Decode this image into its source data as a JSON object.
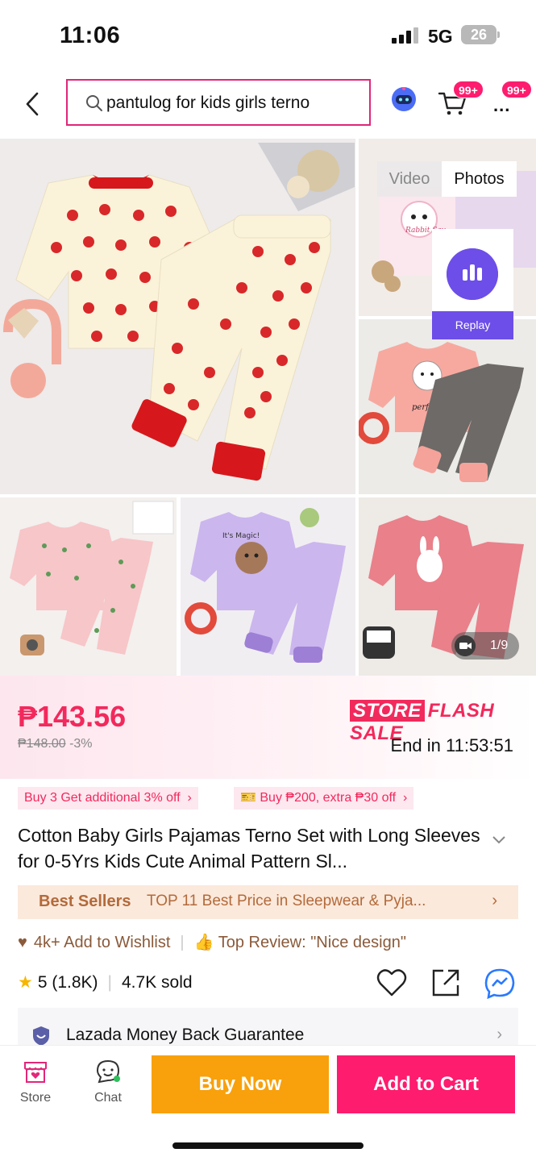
{
  "status_bar": {
    "time": "11:06",
    "network": "5G",
    "battery": "26"
  },
  "header": {
    "search_query": "pantulog for kids girls terno",
    "cart_badge": "99+",
    "more_badge": "99+",
    "more_label": "..."
  },
  "gallery": {
    "video_tab": "Video",
    "photos_tab": "Photos",
    "replay_label": "Replay",
    "image_counter": "1/9",
    "image_texts": {
      "rabbit": "Rabbit Sav",
      "kitty": "perfect day!",
      "magic": "It's Magic!"
    }
  },
  "pricing": {
    "price": "₱143.56",
    "original_price": "₱148.00",
    "discount": "-3%",
    "flash_store": "STORE",
    "flash_sale": "FLASH SALE",
    "ends_in": "End in 11:53:51"
  },
  "promos": [
    {
      "label": "Buy 3 Get additional 3% off"
    },
    {
      "label": "Buy ₱200, extra ₱30 off"
    }
  ],
  "product": {
    "title": "Cotton Baby Girls Pajamas Terno  Set with Long Sleeves for 0-5Yrs Kids Cute Animal Pattern Sl..."
  },
  "best_sellers": {
    "label": "Best Sellers",
    "text": "TOP 11 Best Price in Sleepwear & Pyja..."
  },
  "social": {
    "wishlist": "4k+ Add to Wishlist",
    "top_review": "Top Review: \"Nice design\""
  },
  "rating": {
    "score": "5 (1.8K)",
    "sold": "4.7K sold"
  },
  "guarantee": {
    "label": "Lazada Money Back Guarantee"
  },
  "bottom_bar": {
    "store_label": "Store",
    "chat_label": "Chat",
    "buy_now": "Buy Now",
    "add_to_cart": "Add to Cart"
  },
  "colors": {
    "accent": "#fe1c6f",
    "price": "#f2295c",
    "buy_now": "#f8a10c",
    "best_sellers_bg": "#fbe9dc",
    "replay": "#6d4ee8"
  }
}
